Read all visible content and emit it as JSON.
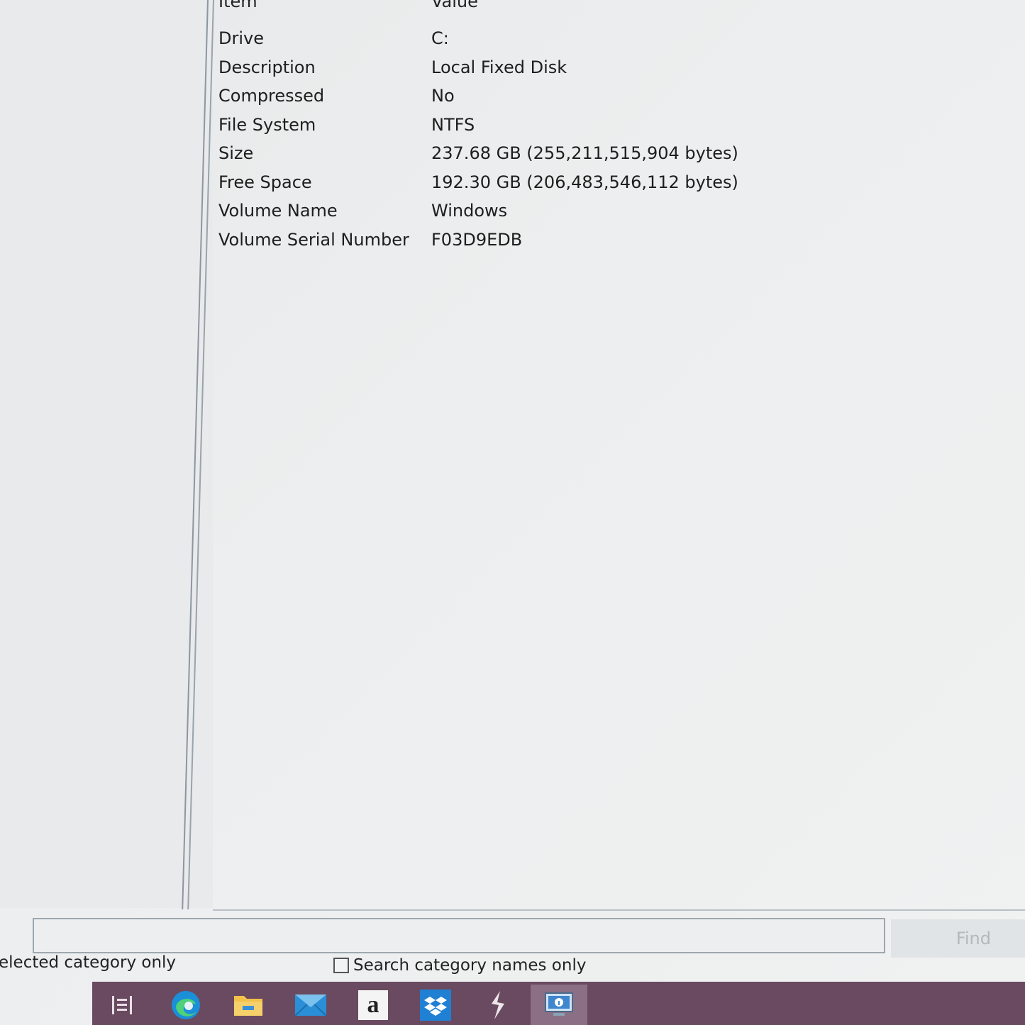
{
  "list": {
    "headers": {
      "item": "Item",
      "value": "Value"
    },
    "rows": [
      {
        "item": "Drive",
        "value": "C:"
      },
      {
        "item": "Description",
        "value": "Local Fixed Disk"
      },
      {
        "item": "Compressed",
        "value": "No"
      },
      {
        "item": "File System",
        "value": "NTFS"
      },
      {
        "item": "Size",
        "value": "237.68 GB (255,211,515,904 bytes)"
      },
      {
        "item": "Free Space",
        "value": "192.30 GB (206,483,546,112 bytes)"
      },
      {
        "item": "Volume Name",
        "value": "Windows"
      },
      {
        "item": "Volume Serial Number",
        "value": "F03D9EDB"
      }
    ]
  },
  "search": {
    "value": "",
    "find_label": "Find",
    "selected_category_label": "elected category only",
    "category_names_label": "Search category names only"
  },
  "taskbar": {
    "items": [
      {
        "icon": "task-view-icon"
      },
      {
        "icon": "edge-icon"
      },
      {
        "icon": "file-explorer-icon"
      },
      {
        "icon": "mail-icon"
      },
      {
        "icon": "amazon-icon",
        "glyph": "a"
      },
      {
        "icon": "dropbox-icon"
      },
      {
        "icon": "app-icon"
      },
      {
        "icon": "system-information-icon"
      }
    ]
  },
  "colors": {
    "taskbar": "#6a4a60",
    "taskbar_active": "#8b6f84",
    "background": "#e9ebec"
  }
}
